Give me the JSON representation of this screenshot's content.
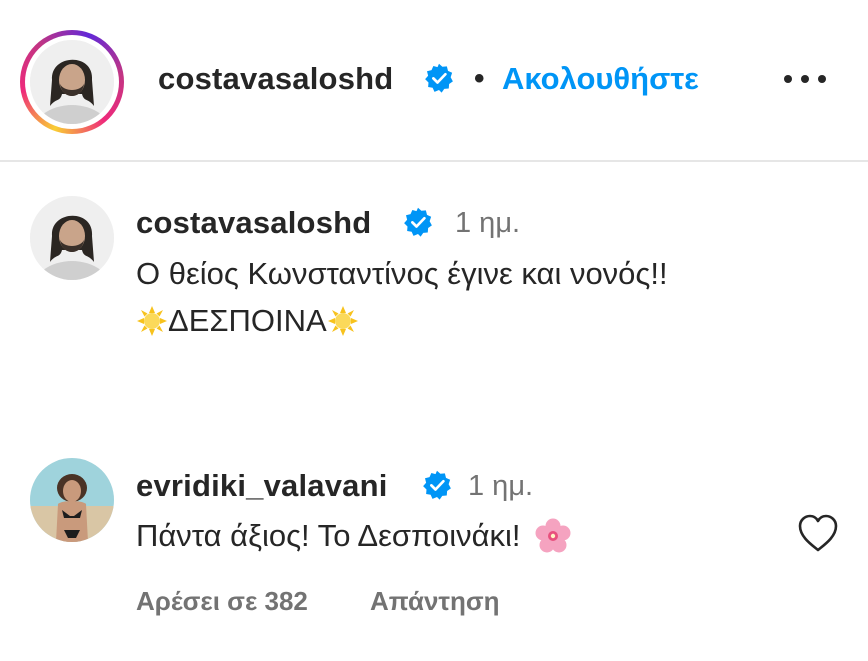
{
  "header": {
    "username": "costavasaloshd",
    "separator": "•",
    "follow_label": "Ακολουθήστε",
    "more_icon": "more-horizontal-icon"
  },
  "caption": {
    "username": "costavasaloshd",
    "time": "1 ημ.",
    "line1": "Ο θείος Κωνσταντίνος έγινε και νονός!!",
    "line2_text": "ΔΕΣΠΟΙΝΑ",
    "line2_emoji": "sun-emoji"
  },
  "comment": {
    "username": "evridiki_valavani",
    "time": "1 ημ.",
    "text": "Πάντα άξιος! Το Δεσποινάκι!",
    "emoji": "cherry-blossom-emoji",
    "likes_label": "Αρέσει σε 382",
    "reply_label": "Απάντηση",
    "like_icon": "heart-outline-icon"
  },
  "colors": {
    "link_blue": "#0095f6",
    "verified_blue": "#0095f6",
    "text": "#262626",
    "muted": "#737373",
    "divider": "#e6e6e6"
  }
}
